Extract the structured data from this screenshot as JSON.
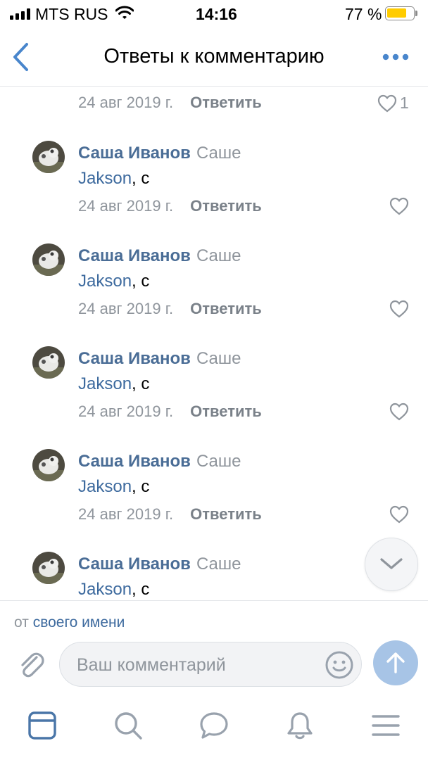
{
  "status_bar": {
    "carrier": "MTS RUS",
    "time": "14:16",
    "battery_percent": "77 %",
    "battery_level": 0.77,
    "battery_color": "#FFCC00"
  },
  "nav": {
    "title": "Ответы к комментарию",
    "back_icon": "chevron-left-icon",
    "more_icon": "more-horizontal-icon",
    "accent_color": "#4986CC"
  },
  "first_item": {
    "date": "24 авг 2019 г.",
    "reply_label": "Ответить",
    "likes": "1"
  },
  "comments": [
    {
      "author": "Саша Иванов",
      "addressee": "Саше",
      "mention": "Jakson",
      "text": ", с",
      "date": "24 авг 2019 г.",
      "reply_label": "Ответить"
    },
    {
      "author": "Саша Иванов",
      "addressee": "Саше",
      "mention": "Jakson",
      "text": ", с",
      "date": "24 авг 2019 г.",
      "reply_label": "Ответить"
    },
    {
      "author": "Саша Иванов",
      "addressee": "Саше",
      "mention": "Jakson",
      "text": ", с",
      "date": "24 авг 2019 г.",
      "reply_label": "Ответить"
    },
    {
      "author": "Саша Иванов",
      "addressee": "Саше",
      "mention": "Jakson",
      "text": ", с",
      "date": "24 авг 2019 г.",
      "reply_label": "Ответить"
    },
    {
      "author": "Саша Иванов",
      "addressee": "Саше",
      "mention": "Jakson",
      "text": ", с"
    }
  ],
  "composer": {
    "from_prefix": "от",
    "from_link": "своего имени",
    "placeholder": "Ваш комментарий",
    "attach_icon": "paperclip-icon",
    "emoji_icon": "smile-icon",
    "send_icon": "arrow-up-icon",
    "send_color": "#A7C4E6"
  },
  "tab_bar": {
    "tabs": [
      "news-tab-icon",
      "search-icon",
      "messages-icon",
      "notifications-bell-icon",
      "menu-icon"
    ],
    "active_color": "#4A76A8",
    "inactive_color": "#99A2AD"
  }
}
